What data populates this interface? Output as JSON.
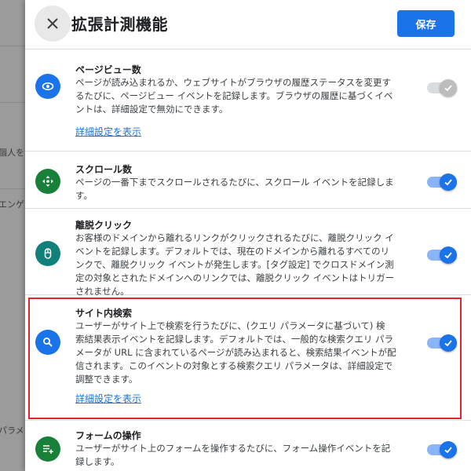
{
  "background": {
    "snippets": [
      "個人を",
      "エンゲー",
      "パラメ"
    ]
  },
  "header": {
    "title": "拡張計測機能",
    "save_label": "保存"
  },
  "items": [
    {
      "name": "ページビュー数",
      "lines": [
        "ページが読み込まれるか、ウェブサイトがブラウザの履歴ステータスを変更す",
        "るたびに、ページビュー イベントを記録します。ブラウザの履歴に基づくイベ",
        "ントは、詳細設定で無効にできます。"
      ],
      "link": "詳細設定を表示",
      "icon": "eye-icon",
      "icon_color": "#1a73e8",
      "enabled": false
    },
    {
      "name": "スクロール数",
      "lines": [
        "ページの一番下までスクロールされるたびに、スクロール イベントを記録しま",
        "す。"
      ],
      "icon": "move-arrows-icon",
      "icon_color": "#188038",
      "enabled": true
    },
    {
      "name": "離脱クリック",
      "lines": [
        "お客様のドメインから離れるリンクがクリックされるたびに、離脱クリック イ",
        "ベントを記録します。デフォルトでは、現在のドメインから離れるすべてのリ",
        "ンクで、離脱クリック イベントが発生します。[タグ設定] でクロスドメイン測",
        "定の対象とされたドメインへのリンクでは、離脱クリック イベントはトリガー",
        "されません。"
      ],
      "icon": "mouse-icon",
      "icon_color": "#12807a",
      "enabled": true
    },
    {
      "name": "サイト内検索",
      "lines": [
        "ユーザーがサイト上で検索を行うたびに、(クエリ パラメータに基づいて) 検",
        "索結果表示イベントを記録します。デフォルトでは、一般的な検索クエリ パラ",
        "メータが URL に含まれているページが読み込まれると、検索結果イベントが配",
        "信されます。このイベントの対象とする検索クエリ パラメータは、詳細設定で",
        "調整できます。"
      ],
      "link": "詳細設定を表示",
      "icon": "search-icon",
      "icon_color": "#1a73e8",
      "enabled": true
    },
    {
      "name": "フォームの操作",
      "lines": [
        "ユーザーがサイト上のフォームを操作するたびに、フォーム操作イベントを記",
        "録します。"
      ],
      "icon": "playlist-add-icon",
      "icon_color": "#188038",
      "enabled": true
    }
  ],
  "colors": {
    "accent": "#1a73e8",
    "highlight_border": "#e3232a"
  }
}
